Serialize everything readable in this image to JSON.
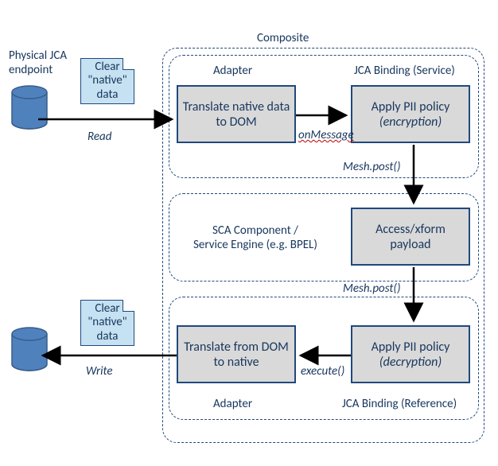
{
  "labels": {
    "composite": "Composite",
    "endpoint": "Physical JCA\nendpoint",
    "adapter_top": "Adapter",
    "jca_service": "JCA Binding (Service)",
    "sca_component": "SCA Component /\nService Engine (e.g. BPEL)",
    "adapter_bottom": "Adapter",
    "jca_reference": "JCA Binding (Reference)",
    "read": "Read",
    "write": "Write",
    "on_message": "onMessage",
    "mesh_post1": "Mesh.post()",
    "mesh_post2": "Mesh.post()",
    "execute": "execute()",
    "note_top": "Clear\n\"native\"\ndata",
    "note_bottom": "Clear\n\"native\"\ndata"
  },
  "boxes": {
    "translate_to_dom": "Translate native\ndata to DOM",
    "apply_enc": "Apply PII policy",
    "apply_enc_sub": "(encryption)",
    "access_xform": "Access/xform\npayload",
    "translate_from_dom": "Translate from\nDOM to native",
    "apply_dec": "Apply PII policy",
    "apply_dec_sub": "(decryption)"
  },
  "colors": {
    "line": "#1f497d",
    "arrow": "#000000",
    "note_bg": "#c6e2f2",
    "box_bg": "#d9d9d9",
    "cyl_fill": "#4f81bd",
    "cyl_stroke": "#385d8a"
  }
}
